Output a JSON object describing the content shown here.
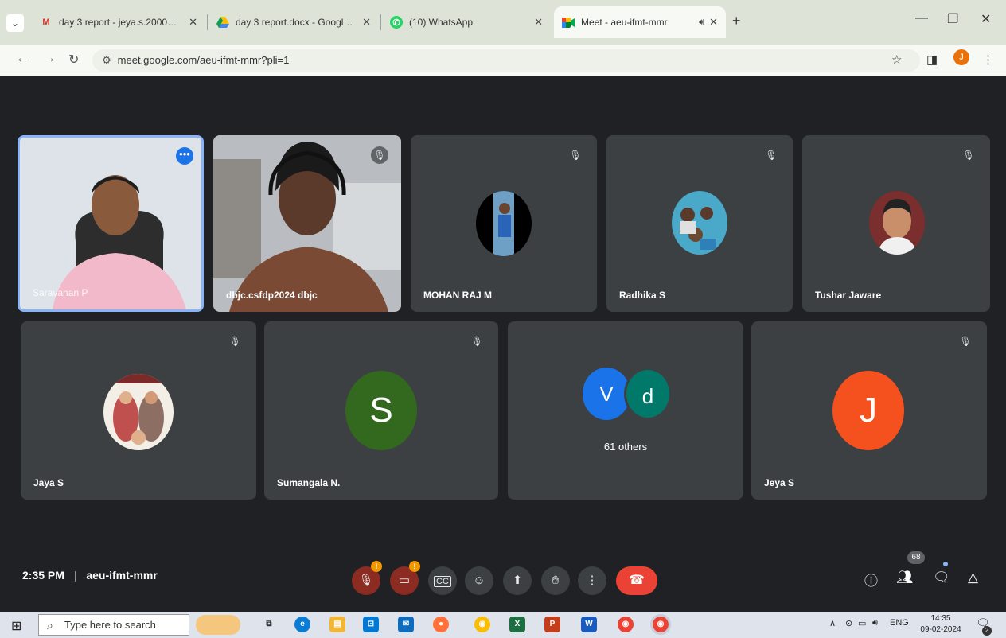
{
  "tabs": [
    {
      "title": "day 3 report - jeya.s.2000@gm",
      "icon": "gmail-icon"
    },
    {
      "title": "day 3 report.docx - Google Dri",
      "icon": "drive-icon"
    },
    {
      "title": "(10) WhatsApp",
      "icon": "whatsapp-icon"
    },
    {
      "title": "Meet - aeu-ifmt-mmr",
      "icon": "meet-icon"
    }
  ],
  "address": {
    "url": "meet.google.com/aeu-ifmt-mmr?pli=1"
  },
  "profile_initial": "J",
  "participants_row1": [
    {
      "name": "Saravanan P",
      "type": "video-man"
    },
    {
      "name": "dbjc.csfdp2024 dbjc",
      "type": "video-woman"
    },
    {
      "name": "MOHAN RAJ M",
      "type": "photo"
    },
    {
      "name": "Radhika S",
      "type": "photo"
    },
    {
      "name": "Tushar Jaware",
      "type": "photo"
    }
  ],
  "participants_row2": [
    {
      "name": "Jaya S",
      "type": "photo"
    },
    {
      "name": "Sumangala N.",
      "letter": "S",
      "color": "#33691e"
    },
    {
      "name": "",
      "others": "61 others",
      "letters": [
        "V",
        "d"
      ],
      "colors": [
        "#1a73e8",
        "#00796b"
      ]
    },
    {
      "name": "Jeya S",
      "letter": "J",
      "color": "#f4511e"
    }
  ],
  "meeting": {
    "time": "2:35 PM",
    "separator": "|",
    "code": "aeu-ifmt-mmr"
  },
  "badges": {
    "warn": "!",
    "people_count": "68"
  },
  "taskbar": {
    "search_placeholder": "Type here to search",
    "lang": "ENG",
    "clock_time": "14:35",
    "clock_date": "09-02-2024",
    "notif_count": "2"
  },
  "colors": {
    "end_call": "#ea4335",
    "accent": "#1a73e8",
    "mic_off_bg": "#ea4335"
  }
}
